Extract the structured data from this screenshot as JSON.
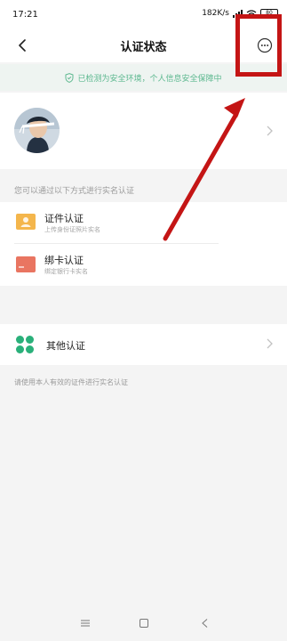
{
  "status_bar": {
    "time": "17:21",
    "network_speed": "182K/s",
    "battery": "80",
    "signal_icon": "signal-icon",
    "wifi_icon": "wifi-icon"
  },
  "nav": {
    "title": "认证状态",
    "back_icon": "back-arrow-icon",
    "more_icon": "more-options-icon"
  },
  "notice": {
    "text": "已检测为安全环境，个人信息安全保障中",
    "icon": "shield-check-icon",
    "color": "#5cb88f"
  },
  "profile": {
    "avatar": "user-avatar",
    "chevron": "chevron-right-icon"
  },
  "section_hint": "您可以通过以下方式进行实名认证",
  "methods": [
    {
      "title": "证件认证",
      "subtitle": "上传身份证照片实名",
      "icon": "id-card-icon",
      "color": "#f4b64c"
    },
    {
      "title": "绑卡认证",
      "subtitle": "绑定银行卡实名",
      "icon": "bank-card-icon",
      "color": "#e97561"
    }
  ],
  "other": {
    "title": "其他认证",
    "icon": "other-methods-icon",
    "color": "#2ab07a"
  },
  "bottom_hint": "请使用本人有效的证件进行实名认证",
  "gesture_bar": {
    "menu_icon": "menu-icon",
    "home_icon": "home-icon",
    "back_icon": "back-icon"
  },
  "annotation_color": "#c41515"
}
